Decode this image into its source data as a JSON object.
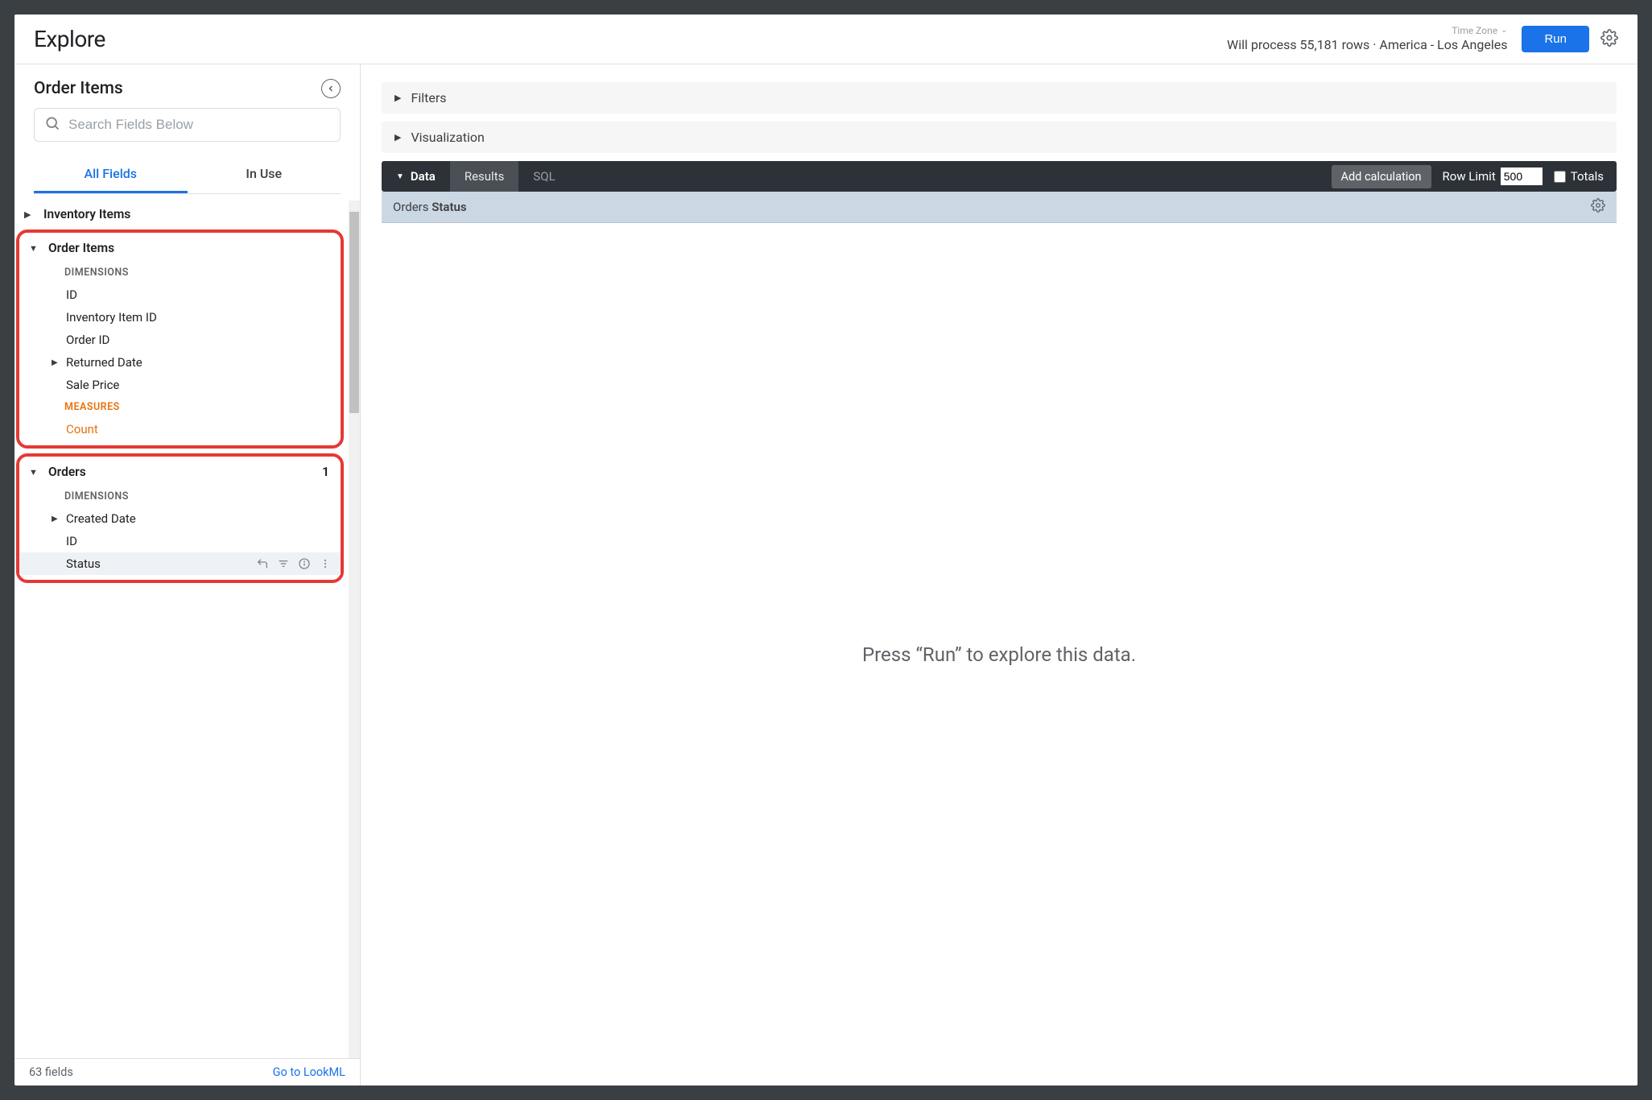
{
  "header": {
    "title": "Explore",
    "timezone_label": "Time Zone",
    "status": "Will process 55,181 rows · America - Los Angeles",
    "run_label": "Run"
  },
  "sidebar": {
    "title": "Order Items",
    "search_placeholder": "Search Fields Below",
    "tabs": {
      "all_fields": "All Fields",
      "in_use": "In Use"
    },
    "views": {
      "inventory_items": {
        "label": "Inventory Items"
      },
      "order_items": {
        "label": "Order Items",
        "dimensions_label": "DIMENSIONS",
        "dimensions": {
          "id": "ID",
          "inventory_item_id": "Inventory Item ID",
          "order_id": "Order ID",
          "returned_date": "Returned Date",
          "sale_price": "Sale Price"
        },
        "measures_label": "MEASURES",
        "measures": {
          "count": "Count"
        }
      },
      "orders": {
        "label": "Orders",
        "badge": "1",
        "dimensions_label": "DIMENSIONS",
        "dimensions": {
          "created_date": "Created Date",
          "id": "ID",
          "status": "Status"
        }
      }
    },
    "footer": {
      "count": "63 fields",
      "link": "Go to LookML"
    }
  },
  "main": {
    "filters_label": "Filters",
    "visualization_label": "Visualization",
    "data_label": "Data",
    "results_label": "Results",
    "sql_label": "SQL",
    "add_calc_label": "Add calculation",
    "row_limit_label": "Row Limit",
    "row_limit_value": "500",
    "totals_label": "Totals",
    "column_header_view": "Orders ",
    "column_header_field": "Status",
    "run_prompt": "Press “Run” to explore this data."
  }
}
